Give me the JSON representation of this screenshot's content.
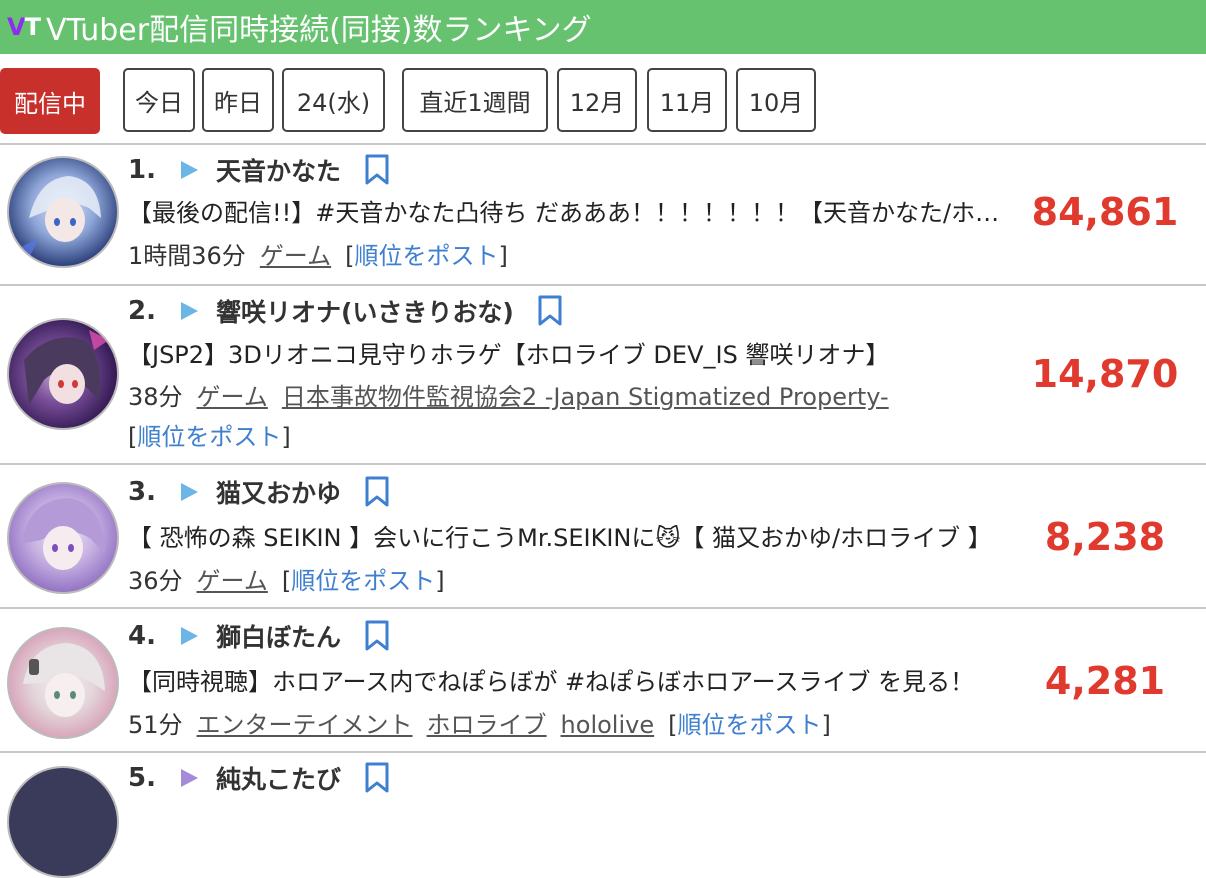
{
  "header": {
    "logo_v": "V",
    "logo_t": "T",
    "title": "VTuber配信同時接続(同接)数ランキング",
    "color": "#66c26f"
  },
  "tabs": [
    {
      "label": "配信中",
      "active": true
    },
    {
      "label": "今日"
    },
    {
      "label": "昨日"
    },
    {
      "label": "24(水)"
    },
    {
      "label": "直近1週間"
    },
    {
      "label": "12月"
    },
    {
      "label": "11月"
    },
    {
      "label": "10月"
    }
  ],
  "rows": [
    {
      "rank": "1.",
      "channel": "天音かなた",
      "title": "【最後の配信!!】#天音かなた凸待ち だあああ！！！！！！！【天音かなた/ホロライブ】",
      "duration": "1時間36分",
      "tags": [
        "ゲーム"
      ],
      "post_label": "順位をポスト",
      "viewers": "84,861"
    },
    {
      "rank": "2.",
      "channel": "響咲リオナ(いさきりおな)",
      "title": "【JSP2】3Dリオニコ見守りホラゲ【ホロライブ DEV_IS 響咲リオナ】",
      "duration": "38分",
      "tags": [
        "ゲーム",
        "日本事故物件監視協会2 -Japan Stigmatized Property-"
      ],
      "post_label": "順位をポスト",
      "viewers": "14,870"
    },
    {
      "rank": "3.",
      "channel": "猫又おかゆ",
      "title": "【 恐怖の森 SEIKIN 】会いに行こうMr.SEIKINに😼【 猫又おかゆ/ホロライブ 】",
      "duration": "36分",
      "tags": [
        "ゲーム"
      ],
      "post_label": "順位をポスト",
      "viewers": "8,238"
    },
    {
      "rank": "4.",
      "channel": "獅白ぼたん",
      "title": "【同時視聴】ホロアース内でねぽらぼが #ねぽらぼホロアースライブ を見る！",
      "duration": "51分",
      "tags": [
        "エンターテイメント",
        "ホロライブ",
        "hololive"
      ],
      "post_label": "順位をポスト",
      "viewers": "4,281"
    },
    {
      "rank": "5.",
      "channel": "純丸こたび"
    }
  ]
}
